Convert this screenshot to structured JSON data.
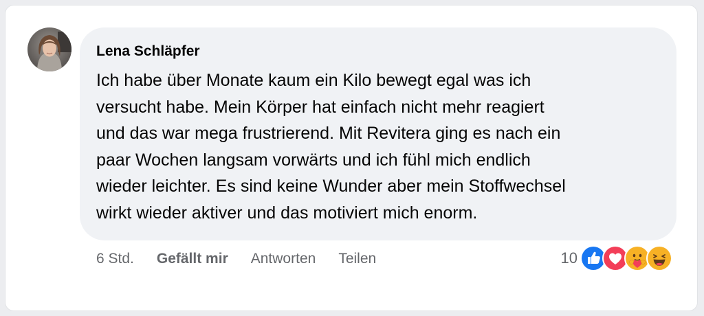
{
  "comment": {
    "author": "Lena Schläpfer",
    "text": "Ich habe über Monate kaum ein Kilo bewegt egal was ich\nversucht habe. Mein Körper hat einfach nicht mehr reagiert\nund das war mega frustrierend. Mit Revitera ging es nach ein\npaar Wochen langsam vorwärts und ich fühl mich endlich\nwieder leichter. Es sind keine Wunder aber mein Stoffwechsel\nwirkt wieder aktiver und das motiviert mich enorm.",
    "timestamp": "6 Std.",
    "like_label": "Gefällt mir",
    "reply_label": "Antworten",
    "share_label": "Teilen",
    "reaction_count": "10",
    "reactions": [
      "like-icon",
      "love-icon",
      "care-icon",
      "haha-icon"
    ]
  },
  "colors": {
    "bubble": "#f0f2f5",
    "text": "#050505",
    "secondary": "#65676b",
    "like_blue": "#1877f2",
    "love_red": "#f33e58",
    "emoji_yellow": "#f7b125"
  }
}
